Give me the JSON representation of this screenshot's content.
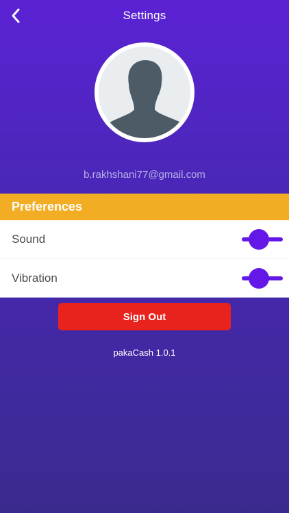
{
  "header": {
    "title": "Settings",
    "back_icon": "chevron-left-icon"
  },
  "profile": {
    "avatar_icon": "user-silhouette-icon",
    "email": "b.rakhshani77@gmail.com"
  },
  "preferences": {
    "title": "Preferences",
    "items": [
      {
        "label": "Sound",
        "enabled": true
      },
      {
        "label": "Vibration",
        "enabled": true
      }
    ]
  },
  "actions": {
    "sign_out_label": "Sign Out"
  },
  "footer": {
    "version": "pakaCash 1.0.1"
  },
  "colors": {
    "background_top": "#5b22d4",
    "background_bottom": "#3b2a8e",
    "preferences_header": "#f2ad25",
    "toggle": "#6418e8",
    "sign_out": "#e8231d"
  }
}
